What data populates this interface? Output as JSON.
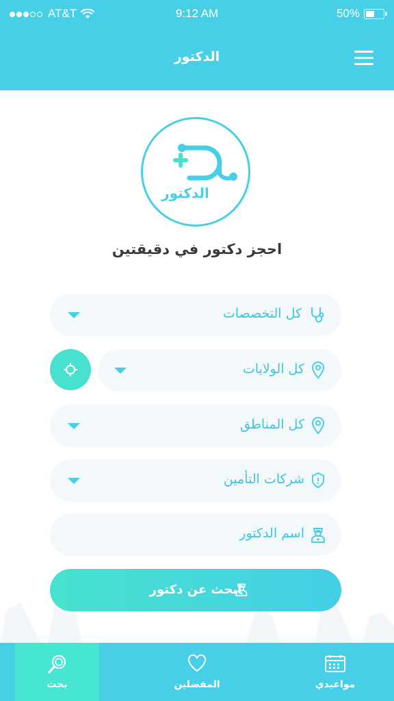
{
  "status_bar": {
    "carrier": "AT&T",
    "time": "9:12 AM",
    "battery": "50%"
  },
  "header": {
    "title": "الدكتور"
  },
  "logo": {
    "text": "الدكتور"
  },
  "tagline": "احجز دكتور في دقيقتين",
  "form": {
    "specialty": {
      "label": "كل التخصصات"
    },
    "state": {
      "label": "كل الولايات"
    },
    "area": {
      "label": "كل المناطق"
    },
    "insurance": {
      "label": "شركات التأمين"
    },
    "doctor_name": {
      "placeholder": "اسم الدكتور"
    }
  },
  "search_button": {
    "label": "ابحث عن دكتور"
  },
  "tabbar": {
    "items": [
      {
        "label": "بحث",
        "icon": "search-icon",
        "active": true
      },
      {
        "label": "المفضلين",
        "icon": "heart-icon",
        "active": false
      },
      {
        "label": "مواعيدي",
        "icon": "calendar-icon",
        "active": false
      }
    ]
  },
  "colors": {
    "primary": "#46cfe6",
    "accent": "#47e6d2",
    "field_bg": "#f3f8fb",
    "text": "#3a3a3a"
  }
}
